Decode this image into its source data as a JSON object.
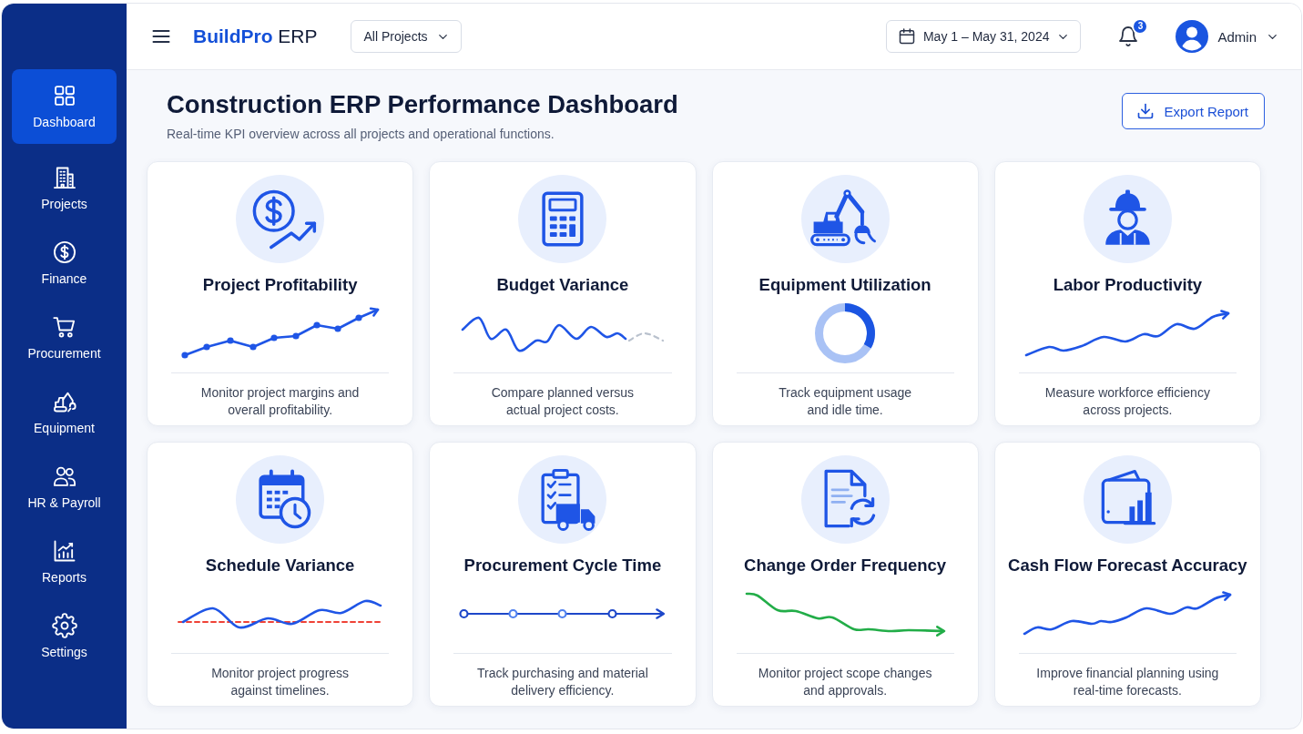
{
  "sidebar": {
    "items": [
      {
        "label": "Dashboard",
        "selected": true
      },
      {
        "label": "Projects",
        "selected": false
      },
      {
        "label": "Finance",
        "selected": false
      },
      {
        "label": "Procurement",
        "selected": false
      },
      {
        "label": "Equipment",
        "selected": false
      },
      {
        "label": "HR & Payroll",
        "selected": false
      },
      {
        "label": "Reports",
        "selected": false
      },
      {
        "label": "Settings",
        "selected": false
      }
    ]
  },
  "top_bar": {
    "brand": "**BuildPro** ERP",
    "project_filter": "All Projects",
    "date_range": "May 1 – May 31, 2024",
    "notification_count": "3",
    "user": "Admin"
  },
  "header": {
    "title": "Construction ERP Performance Dashboard",
    "subtitle": "Real-time KPI overview across all projects and operational functions.",
    "export_button": "Export Report"
  },
  "cards": [
    {
      "title": "Project Profitability",
      "kind": "dots",
      "description": "Monitor project margins and\noverall profitability."
    },
    {
      "title": "Budget Variance",
      "kind": "wave",
      "description": "Compare planned versus\nactual project costs."
    },
    {
      "title": "Equipment Utilization",
      "kind": "donut",
      "description": "Track equipment usage\nand idle time."
    },
    {
      "title": "Labor Productivity",
      "kind": "trend",
      "description": "Measure workforce efficiency\nacross projects."
    },
    {
      "title": "Schedule Variance",
      "kind": "variance",
      "description": "Monitor project progress\nagainst timelines."
    },
    {
      "title": "Procurement Cycle Time",
      "kind": "milestones",
      "description": "Track purchasing and material\ndelivery efficiency."
    },
    {
      "title": "Change Order Frequency",
      "kind": "decline",
      "description": "Monitor project scope changes\nand approvals."
    },
    {
      "title": "Cash Flow Forecast Accuracy",
      "kind": "forecast",
      "description": "Improve financial planning using\nreal-time forecasts."
    }
  ]
}
